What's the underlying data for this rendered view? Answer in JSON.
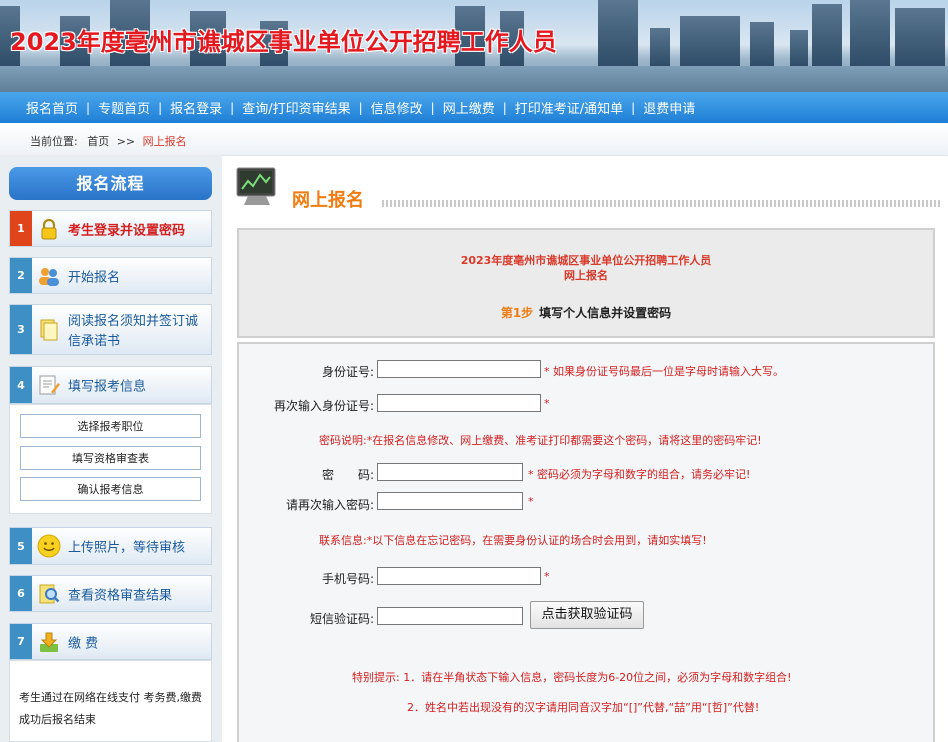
{
  "banner": {
    "title": "2023年度亳州市谯城区事业单位公开招聘工作人员"
  },
  "nav": [
    "报名首页",
    "专题首页",
    "报名登录",
    "查询/打印资审结果",
    "信息修改",
    "网上缴费",
    "打印准考证/通知单",
    "退费申请"
  ],
  "nav_separator": "|",
  "breadcrumb": {
    "label": "当前位置:",
    "home": "首页",
    "sep": ">>",
    "current": "网上报名"
  },
  "sidebar": {
    "title": "报名流程",
    "steps": [
      {
        "num": "1",
        "label": "考生登录并设置密码",
        "icon": "lock-icon"
      },
      {
        "num": "2",
        "label": "开始报名",
        "icon": "users-icon"
      },
      {
        "num": "3",
        "label": "阅读报名须知并签订诚信承诺书",
        "icon": "document-icon"
      },
      {
        "num": "4",
        "label": "填写报考信息",
        "icon": "edit-icon"
      },
      {
        "num": "5",
        "label": "上传照片，等待审核",
        "icon": "smiley-icon"
      },
      {
        "num": "6",
        "label": "查看资格审查结果",
        "icon": "search-icon"
      },
      {
        "num": "7",
        "label": "缴 费",
        "icon": "download-arrow-icon"
      }
    ],
    "sub_buttons": [
      "选择报考职位",
      "填写资格审查表",
      "确认报考信息"
    ],
    "pay_note": "考生通过在网络在线支付 考务费,缴费成功后报名结束"
  },
  "main": {
    "page_title": "网上报名",
    "info_line1": "2023年度亳州市谯城区事业单位公开招聘工作人员",
    "info_line2": "网上报名",
    "step_no": "第1步",
    "step_title": "填写个人信息并设置密码",
    "form": {
      "id_label": "身份证号:",
      "id_hint": "* 如果身份证号码最后一位是字母时请输入大写。",
      "id_confirm_label": "再次输入身份证号:",
      "id_confirm_hint": "*",
      "pwd_note": "密码说明:*在报名信息修改、网上缴费、准考证打印都需要这个密码，请将这里的密码牢记!",
      "pwd_label": "密　　码:",
      "pwd_hint": "* 密码必须为字母和数字的组合，请务必牢记!",
      "pwd_confirm_label": "请再次输入密码:",
      "pwd_confirm_hint": "*",
      "contact_note": "联系信息:*以下信息在忘记密码，在需要身份认证的场合时会用到，请如实填写!",
      "phone_label": "手机号码:",
      "phone_hint": "*",
      "sms_label": "短信验证码:",
      "sms_button": "点击获取验证码",
      "tip1": "特别提示:  1．请在半角状态下输入信息，密码长度为6-20位之间，必须为字母和数字组合!",
      "tip2": "2．姓名中若出现没有的汉字请用同音汉字加“[]”代替,“喆”用“[哲]”代替!"
    }
  },
  "colors": {
    "accent_red": "#d32020",
    "orange": "#ef7d12",
    "nav_blue": "#2a86db"
  }
}
